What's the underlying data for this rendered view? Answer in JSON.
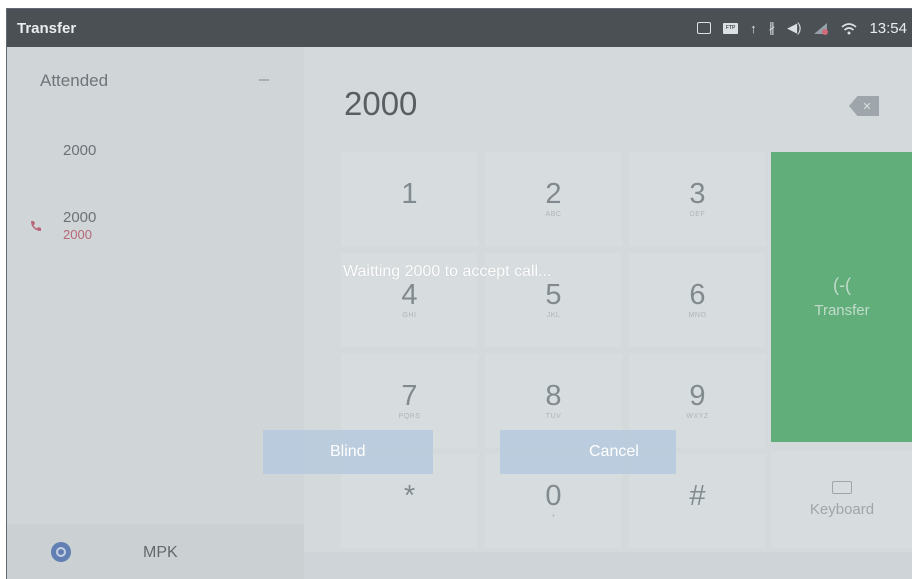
{
  "statusbar": {
    "title": "Transfer",
    "icons": [
      "screenshot-icon",
      "ftp-icon",
      "upload-icon",
      "bluetooth-icon",
      "volume-icon",
      "network-alert-icon",
      "wifi-icon"
    ],
    "ftp_text": "FTP",
    "time": "13:54"
  },
  "left_panel": {
    "mode": "Attended",
    "contact": "2000",
    "active_call": {
      "number": "2000",
      "sub": "2000"
    },
    "footer_label": "MPK"
  },
  "dialpad": {
    "number": "2000",
    "keys": [
      {
        "digit": "1",
        "letters": ""
      },
      {
        "digit": "2",
        "letters": "ABC"
      },
      {
        "digit": "3",
        "letters": "DEF"
      },
      {
        "digit": "4",
        "letters": "GHI"
      },
      {
        "digit": "5",
        "letters": "JKL"
      },
      {
        "digit": "6",
        "letters": "MNO"
      },
      {
        "digit": "7",
        "letters": "PQRS"
      },
      {
        "digit": "8",
        "letters": "TUV"
      },
      {
        "digit": "9",
        "letters": "WXYZ"
      },
      {
        "digit": "*",
        "letters": ""
      },
      {
        "digit": "0",
        "letters": "+"
      },
      {
        "digit": "#",
        "letters": ""
      }
    ],
    "transfer_icon": "(-(",
    "transfer_label": "Transfer",
    "keyboard_label": "Keyboard"
  },
  "dialog": {
    "message": "Waitting 2000 to accept call...",
    "blind_label": "Blind",
    "cancel_label": "Cancel"
  },
  "colors": {
    "status_bar": "#0b0f14",
    "transfer_green": "#2f9f4f",
    "missed_red": "#b3304a",
    "mpk_blue": "#2f56a6"
  }
}
